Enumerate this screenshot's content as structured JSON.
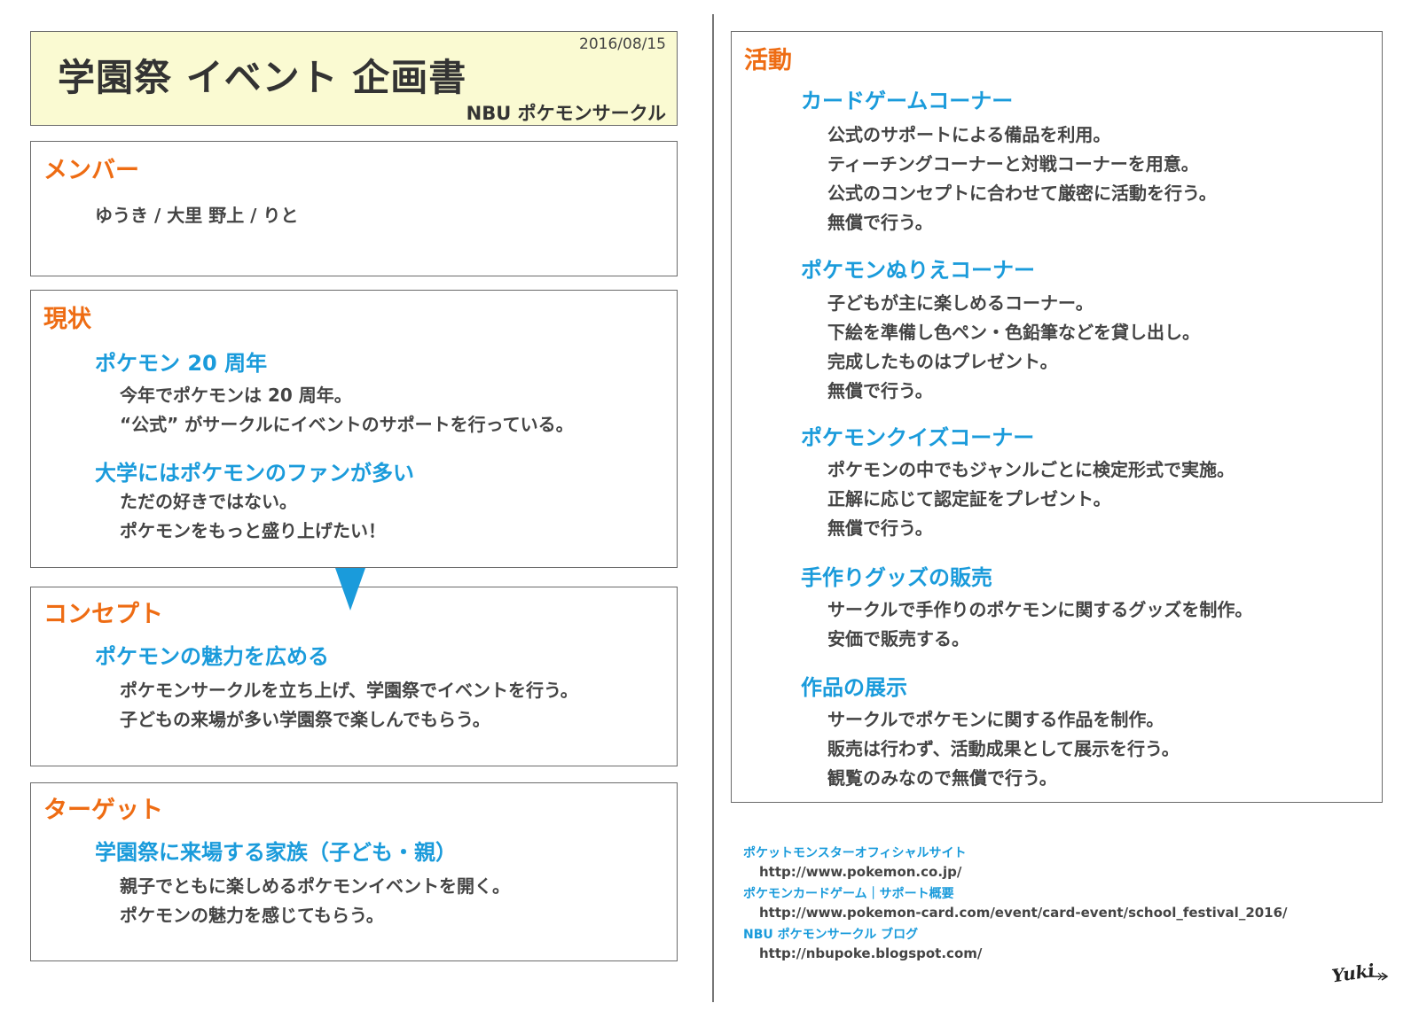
{
  "header": {
    "title": "学園祭 イベント 企画書",
    "date": "2016/08/15",
    "org": "NBU ポケモンサークル"
  },
  "members": {
    "title": "メンバー",
    "names": "ゆうき / 大里 野上 / りと"
  },
  "status": {
    "title": "現状",
    "items": [
      {
        "heading": "ポケモン 20 周年",
        "lines": [
          "今年でポケモンは 20 周年。",
          "“公式” がサークルにイベントのサポートを行っている。"
        ]
      },
      {
        "heading": "大学にはポケモンのファンが多い",
        "lines": [
          "ただの好きではない。",
          "ポケモンをもっと盛り上げたい！"
        ]
      }
    ]
  },
  "concept": {
    "title": "コンセプト",
    "heading": "ポケモンの魅力を広める",
    "lines": [
      "ポケモンサークルを立ち上げ、学園祭でイベントを行う。",
      "子どもの来場が多い学園祭で楽しんでもらう。"
    ]
  },
  "target": {
    "title": "ターゲット",
    "heading": "学園祭に来場する家族（子ども・親）",
    "lines": [
      "親子でともに楽しめるポケモンイベントを開く。",
      "ポケモンの魅力を感じてもらう。"
    ]
  },
  "activities": {
    "title": "活動",
    "items": [
      {
        "heading": "カードゲームコーナー",
        "lines": [
          "公式のサポートによる備品を利用。",
          "ティーチングコーナーと対戦コーナーを用意。",
          "公式のコンセプトに合わせて厳密に活動を行う。",
          "無償で行う。"
        ]
      },
      {
        "heading": "ポケモンぬりえコーナー",
        "lines": [
          "子どもが主に楽しめるコーナー。",
          "下絵を準備し色ペン・色鉛筆などを貸し出し。",
          "完成したものはプレゼント。",
          "無償で行う。"
        ]
      },
      {
        "heading": "ポケモンクイズコーナー",
        "lines": [
          "ポケモンの中でもジャンルごとに検定形式で実施。",
          "正解に応じて認定証をプレゼント。",
          "無償で行う。"
        ]
      },
      {
        "heading": "手作りグッズの販売",
        "lines": [
          "サークルで手作りのポケモンに関するグッズを制作。",
          "安価で販売する。"
        ]
      },
      {
        "heading": "作品の展示",
        "lines": [
          "サークルでポケモンに関する作品を制作。",
          "販売は行わず、活動成果として展示を行う。",
          "観覧のみなので無償で行う。"
        ]
      }
    ]
  },
  "references": [
    {
      "title": "ポケットモンスターオフィシャルサイト",
      "url": "http://www.pokemon.co.jp/"
    },
    {
      "title": "ポケモンカードゲーム｜サポート概要",
      "url": "http://www.pokemon-card.com/event/card-event/school_festival_2016/"
    },
    {
      "title": "NBU ポケモンサークル ブログ",
      "url": "http://nbupoke.blogspot.com/"
    }
  ],
  "signature": "Yuki",
  "colors": {
    "section_title": "#ee6c13",
    "sub_title": "#1a9bdb",
    "title_bg": "#fafad2",
    "arrow": "#1a9bdb"
  }
}
